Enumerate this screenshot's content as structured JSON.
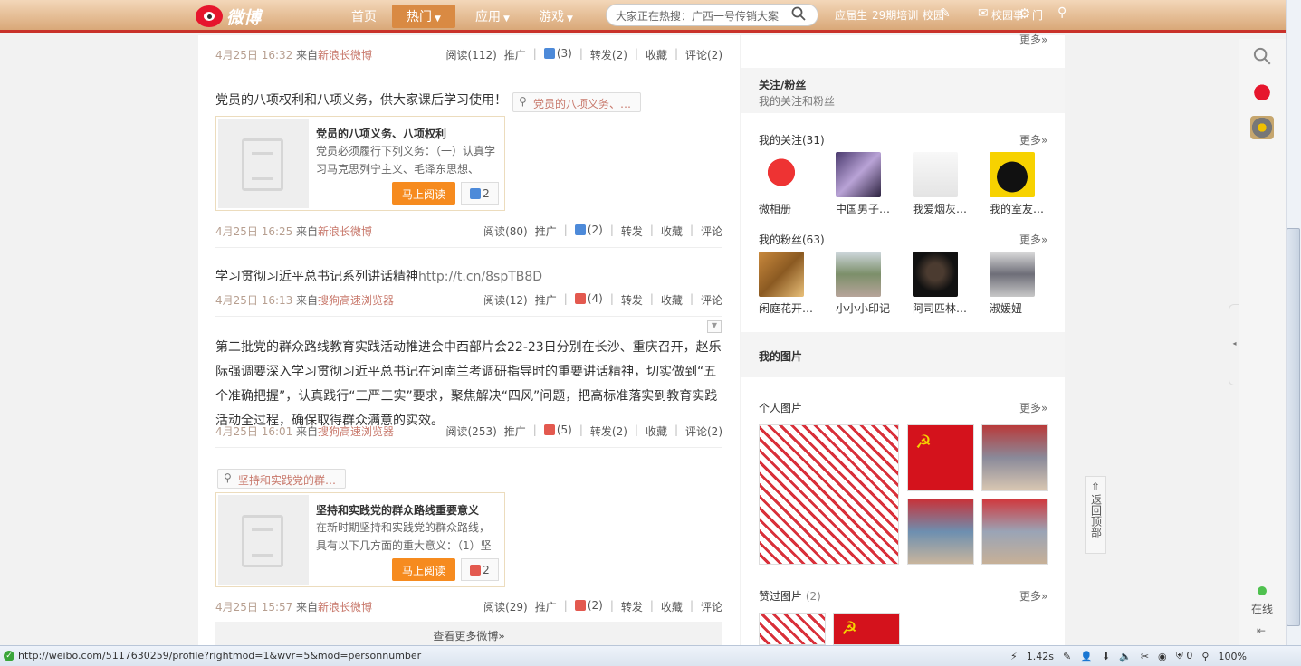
{
  "nav": {
    "logo_text": "微博",
    "home": "首页",
    "hot": "热门",
    "apps": "应用",
    "games": "游戏",
    "search_placeholder": "大家正在热搜：广西一号传销大案",
    "top_links": [
      "应届生",
      "29期培训",
      "校园",
      "校园事",
      "门"
    ]
  },
  "feed": [
    {
      "time": "4月25日 16:32",
      "from_prefix": "来自",
      "from": "新浪长微博",
      "read": "阅读(112)",
      "promote": "推广",
      "likes": "(3)",
      "repost": "转发(2)",
      "fav": "收藏",
      "comment": "评论(2)"
    },
    {
      "text": "党员的八项权利和八项义务，供大家课后学习使用！",
      "tag": "党员的八项义务、…",
      "card_title": "党员的八项义务、八项权利",
      "card_desc": "党员必须履行下列义务：（一）认真学习马克思列宁主义、毛泽东思想、",
      "card_btn": "马上阅读",
      "card_likes": "2",
      "time": "4月25日 16:25",
      "from_prefix": "来自",
      "from": "新浪长微博",
      "read": "阅读(80)",
      "promote": "推广",
      "likes": "(2)",
      "repost": "转发",
      "fav": "收藏",
      "comment": "评论"
    },
    {
      "text": "学习贯彻习近平总书记系列讲话精神",
      "link": "http://t.cn/8spTB8D",
      "time": "4月25日 16:13",
      "from_prefix": "来自",
      "from": "搜狗高速浏览器",
      "read": "阅读(12)",
      "promote": "推广",
      "likes": "(4)",
      "repost": "转发",
      "fav": "收藏",
      "comment": "评论"
    },
    {
      "text": "第二批党的群众路线教育实践活动推进会中西部片会22-23日分别在长沙、重庆召开，赵乐际强调要深入学习贯彻习近平总书记在河南兰考调研指导时的重要讲话精神，切实做到“五个准确把握”，认真践行“三严三实”要求，聚焦解决“四风”问题，把高标准落实到教育实践活动全过程，确保取得群众满意的实效。",
      "time": "4月25日 16:01",
      "from_prefix": "来自",
      "from": "搜狗高速浏览器",
      "read": "阅读(253)",
      "promote": "推广",
      "likes": "(5)",
      "repost": "转发(2)",
      "fav": "收藏",
      "comment": "评论(2)"
    },
    {
      "tag": "坚持和实践党的群…",
      "card_title": "坚持和实践党的群众路线重要意义",
      "card_desc": "在新时期坚持和实践党的群众路线，具有以下几方面的重大意义：（1）坚",
      "card_btn": "马上阅读",
      "card_likes": "2",
      "time": "4月25日 15:57",
      "from_prefix": "来自",
      "from": "新浪长微博",
      "read": "阅读(29)",
      "promote": "推广",
      "likes": "(2)",
      "repost": "转发",
      "fav": "收藏",
      "comment": "评论"
    }
  ],
  "more_weibo": "查看更多微博»",
  "right": {
    "more_top": "更多»",
    "follow_title": "关注/粉丝",
    "follow_sub": "我的关注和粉丝",
    "following_label": "我的关注(31)",
    "more": "更多»",
    "following": [
      "微相册",
      "中国男子…",
      "我爱烟灰…",
      "我的室友…"
    ],
    "fans_label": "我的粉丝(63)",
    "fans": [
      "闲庭花开…",
      "小小小印记",
      "阿司匹林…",
      "淑媛妞"
    ],
    "pics_title": "我的图片",
    "personal_pics": "个人图片",
    "liked_pics": "赞过图片",
    "liked_count": "(2)"
  },
  "sidebar": {
    "online": "在线",
    "back_top": "返回顶部"
  },
  "status": {
    "url": "http://weibo.com/5117630259/profile?rightmod=1&wvr=5&mod=personnumber",
    "speed": "1.42s",
    "zoom": "100%"
  }
}
